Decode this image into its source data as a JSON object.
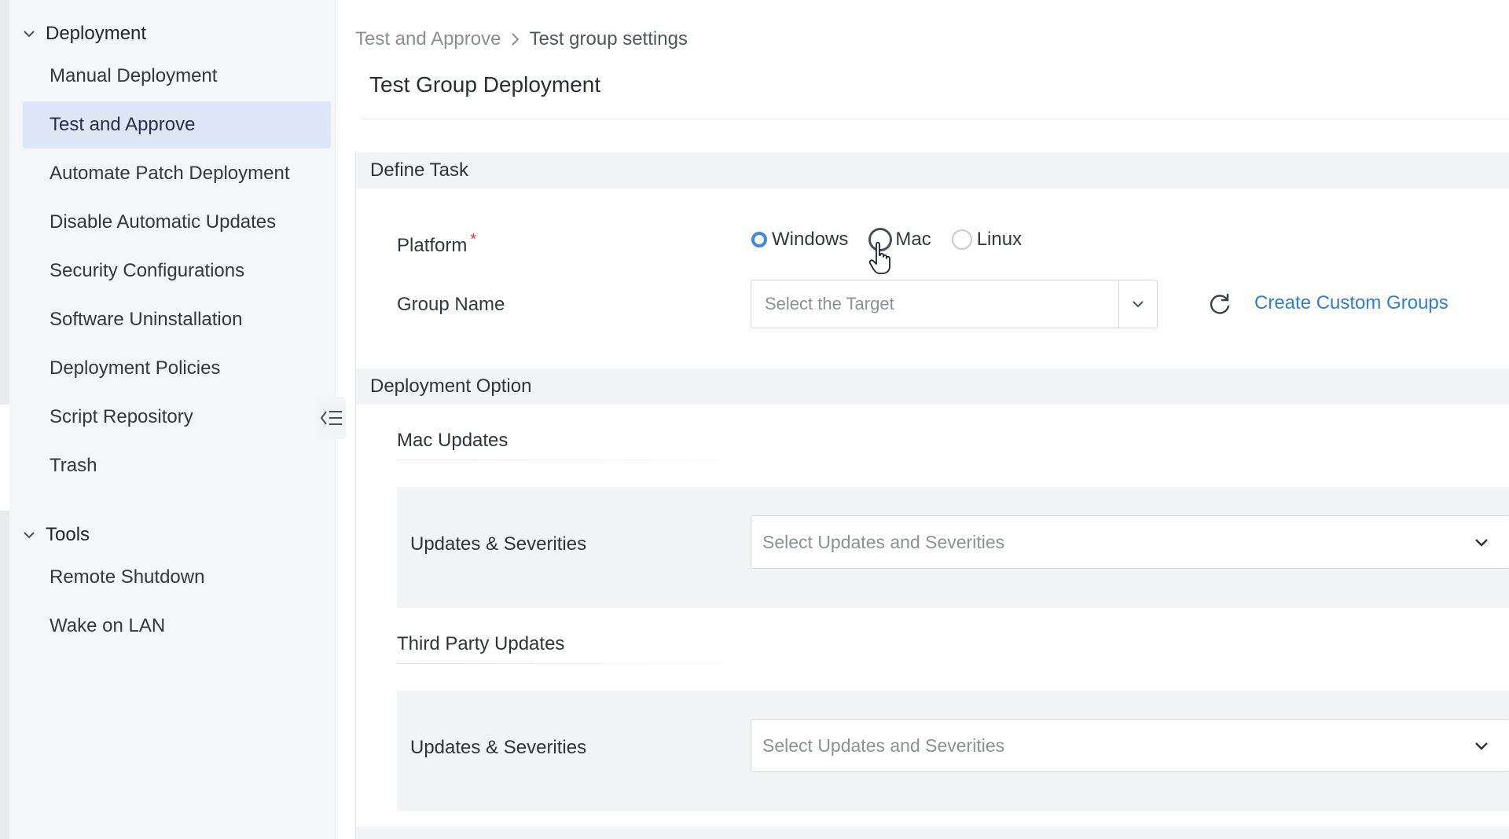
{
  "sidebar": {
    "groups": [
      {
        "title": "Deployment",
        "items": [
          {
            "label": "Manual Deployment",
            "active": false
          },
          {
            "label": "Test and Approve",
            "active": true
          },
          {
            "label": "Automate Patch Deployment",
            "active": false
          },
          {
            "label": "Disable Automatic Updates",
            "active": false
          },
          {
            "label": "Security Configurations",
            "active": false
          },
          {
            "label": "Software Uninstallation",
            "active": false
          },
          {
            "label": "Deployment Policies",
            "active": false
          },
          {
            "label": "Script Repository",
            "active": false
          },
          {
            "label": "Trash",
            "active": false
          }
        ]
      },
      {
        "title": "Tools",
        "items": [
          {
            "label": "Remote Shutdown",
            "active": false
          },
          {
            "label": "Wake on LAN",
            "active": false
          }
        ]
      }
    ],
    "collapse_icon": "collapse-menu-icon"
  },
  "breadcrumb": {
    "parent": "Test and Approve",
    "current": "Test group settings"
  },
  "page_title": "Test Group Deployment",
  "define_task": {
    "title": "Define Task",
    "platform": {
      "label": "Platform",
      "required_mark": "*",
      "options": [
        "Windows",
        "Mac",
        "Linux"
      ],
      "selected": "Windows"
    },
    "group_name": {
      "label": "Group Name",
      "placeholder": "Select the Target",
      "link": "Create Custom Groups"
    }
  },
  "deployment_option": {
    "title": "Deployment Option",
    "sections": [
      {
        "title": "Mac Updates",
        "field_label": "Updates & Severities",
        "placeholder": "Select Updates and Severities"
      },
      {
        "title": "Third Party Updates",
        "field_label": "Updates & Severities",
        "placeholder": "Select Updates and Severities"
      }
    ]
  },
  "colors": {
    "accent": "#2d7fd9",
    "radio_checked": "#3c8be0",
    "active_nav_bg": "#dde6f6",
    "required": "#e0393e"
  }
}
